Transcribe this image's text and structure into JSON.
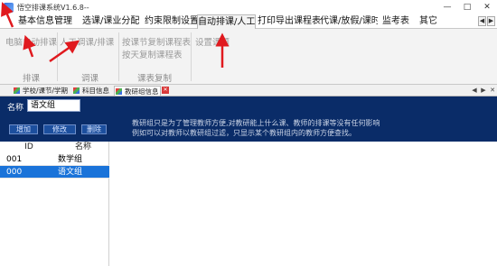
{
  "window": {
    "title": "悟空排课系统V1.6.8--",
    "minimize": "—",
    "maximize": "□",
    "close": "✕"
  },
  "menu": {
    "items": [
      "基本信息管理",
      "选课/课业分配",
      "约束限制设置",
      "自动排课/人工调",
      "打印导出课程表",
      "代课/放假/课时",
      "监考表",
      "其它"
    ],
    "scroll_left": "◀",
    "scroll_right": "▶"
  },
  "ribbon": {
    "auto_schedule": "电脑自动排课",
    "manual_adjust": "人工调课/排课",
    "copy_by_section": "按课节复制课程表",
    "copy_by_day": "按天复制课程表",
    "set_lesson": "设置课题",
    "group_schedule": "排课",
    "group_adjust": "调课",
    "group_copy": "课表复制"
  },
  "tabs": [
    "学校/课节/学期",
    "科目信息",
    "教研组信息"
  ],
  "tab_close": "✕",
  "tab_nav": {
    "prev": "◀",
    "next": "▶",
    "close": "✕"
  },
  "panel": {
    "name_label": "名称",
    "name_value": "语文组",
    "desc_line1": "教研组只是为了管理教师方便,对教研能上什么课、教师的排课等没有任何影响",
    "desc_line2": "例如可以对教师以教研组过滤，只显示某个教研组内的教师方便查找。",
    "add": "增加",
    "edit": "修改",
    "delete": "删除"
  },
  "grid": {
    "columns": [
      "ID",
      "名称"
    ],
    "rows": [
      {
        "id": "001",
        "name": "数学组",
        "selected": false
      },
      {
        "id": "000",
        "name": "语文组",
        "selected": true
      }
    ]
  },
  "colors": {
    "panel_bg": "#0a2c68",
    "selected_row": "#1a73d9",
    "ribbon_bg": "#f3f3f3"
  }
}
